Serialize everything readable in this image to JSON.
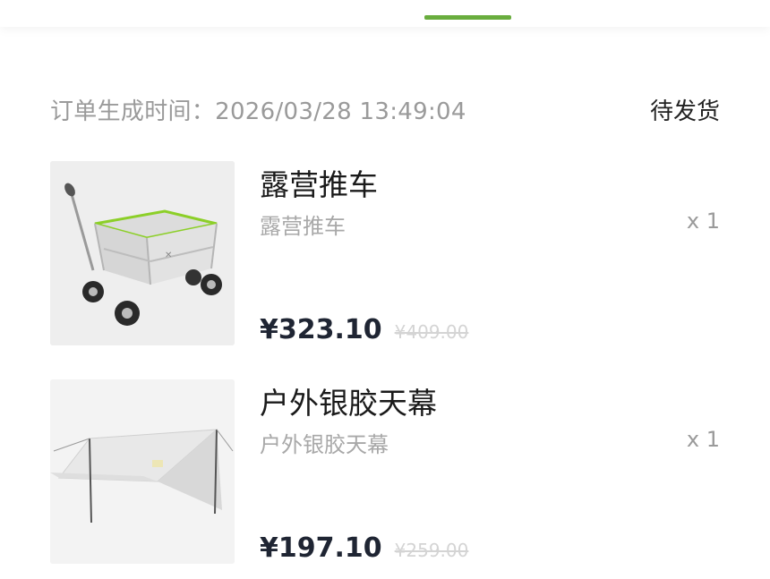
{
  "order": {
    "time_label": "订单生成时间：",
    "time_value": "2026/03/28 13:49:04",
    "status": "待发货"
  },
  "items": [
    {
      "name": "露营推车",
      "spec": "露营推车",
      "qty": "x 1",
      "price": "¥323.10",
      "original_price": "¥409.00",
      "image": "camping-wagon"
    },
    {
      "name": "户外银胶天幕",
      "spec": "户外银胶天幕",
      "qty": "x 1",
      "price": "¥197.10",
      "original_price": "¥259.00",
      "image": "outdoor-tarp"
    }
  ],
  "colors": {
    "accent": "#69ad3e",
    "price": "#1f2533",
    "muted": "#9a9a9a"
  }
}
